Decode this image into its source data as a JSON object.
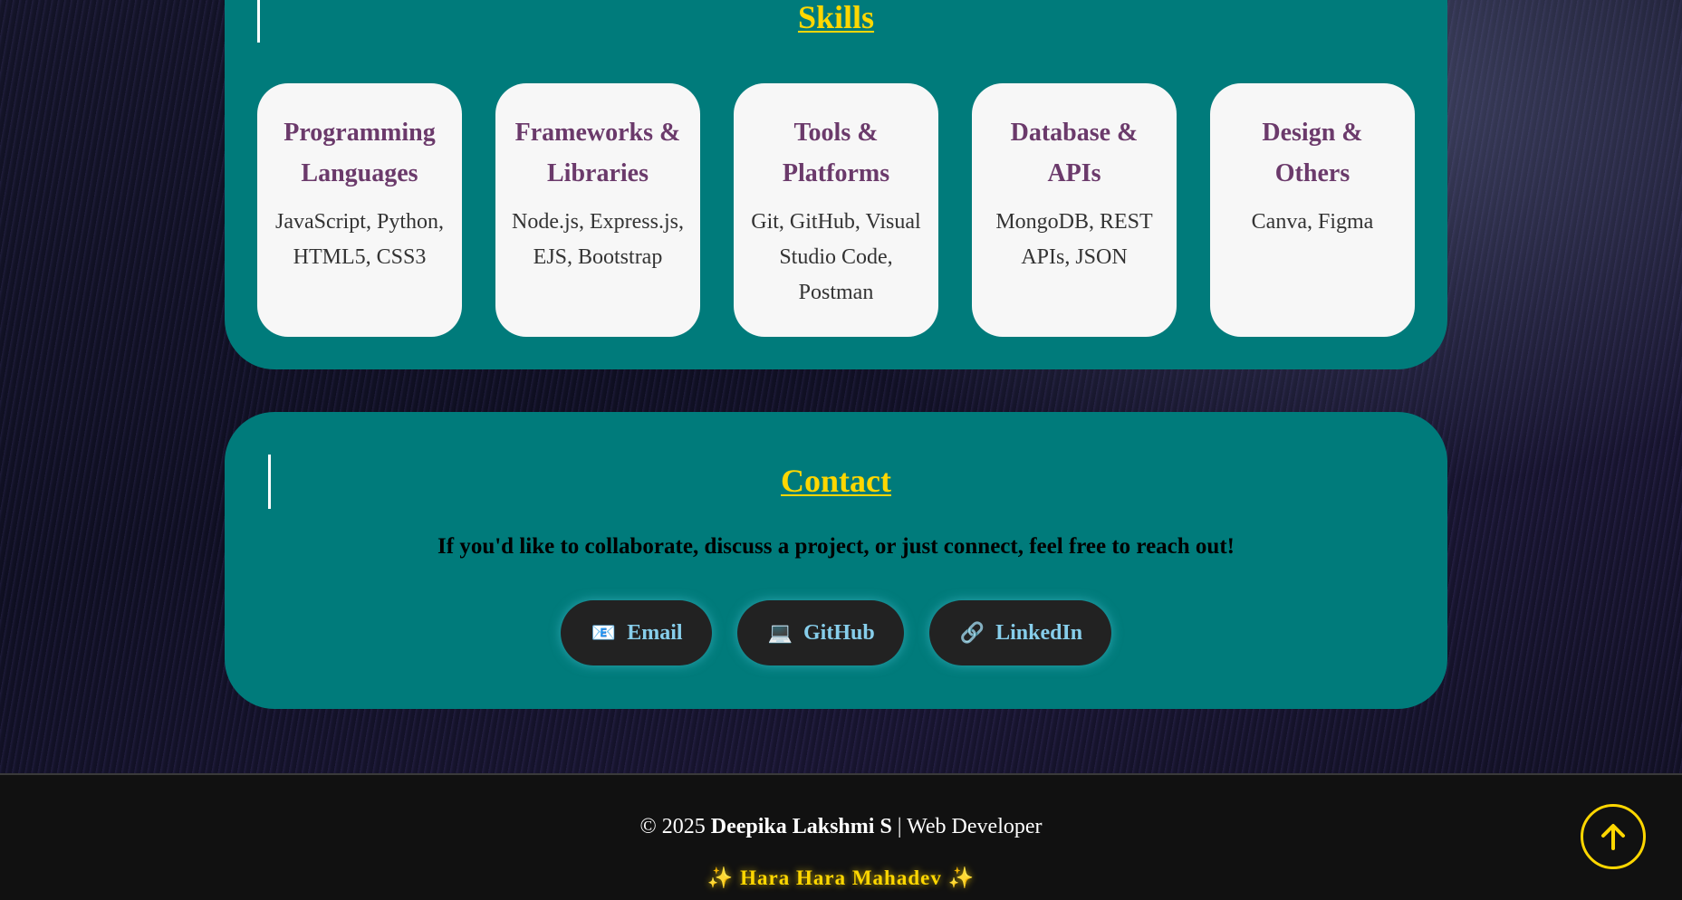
{
  "skills": {
    "title": "Skills",
    "cards": [
      {
        "title": "Programming Languages",
        "text": "JavaScript, Python, HTML5, CSS3"
      },
      {
        "title": "Frameworks & Libraries",
        "text": "Node.js, Express.js, EJS, Bootstrap"
      },
      {
        "title": "Tools & Platforms",
        "text": "Git, GitHub, Visual Studio Code, Postman"
      },
      {
        "title": "Database & APIs",
        "text": "MongoDB, REST APIs, JSON"
      },
      {
        "title": "Design & Others",
        "text": "Canva, Figma"
      }
    ]
  },
  "contact": {
    "title": "Contact",
    "text": "If you'd like to collaborate, discuss a project, or just connect, feel free to reach out!",
    "links": [
      {
        "icon": "email-icon",
        "glyph": "📧",
        "label": "Email"
      },
      {
        "icon": "laptop-icon",
        "glyph": "💻",
        "label": "GitHub"
      },
      {
        "icon": "link-icon",
        "glyph": "🔗",
        "label": "LinkedIn"
      }
    ]
  },
  "footer": {
    "copyright": "© 2025",
    "name": "Deepika Lakshmi S",
    "role": "| Web Developer",
    "sparkle": "✨",
    "motto": "Hara Hara Mahadev"
  },
  "colors": {
    "section_bg": "#007b7b",
    "heading": "#ffd700",
    "card_title": "#6b3a6b",
    "link_text": "#87ceeb"
  }
}
